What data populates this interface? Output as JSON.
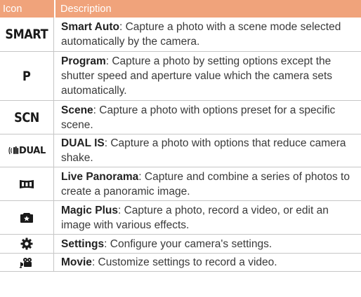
{
  "header": {
    "icon_col": "Icon",
    "desc_col": "Description"
  },
  "rows": [
    {
      "icon_text": "SMART",
      "icon_name": "smart-auto-icon",
      "term": "Smart Auto",
      "desc": ": Capture a photo with a scene mode selected automatically by the camera."
    },
    {
      "icon_text": "P",
      "icon_name": "program-icon",
      "term": "Program",
      "desc": ": Capture a photo by setting options except the shutter speed and aperture value which the camera sets automatically."
    },
    {
      "icon_text": "SCN",
      "icon_name": "scene-icon",
      "term": "Scene",
      "desc": ": Capture a photo with options preset for a specific scene."
    },
    {
      "icon_text": "DUAL",
      "icon_name": "dual-is-icon",
      "term": "DUAL IS",
      "desc": ": Capture a photo with options that reduce camera shake."
    },
    {
      "icon_name": "live-panorama-icon",
      "term": "Live Panorama",
      "desc": ": Capture and combine a series of photos to create a panoramic image."
    },
    {
      "icon_name": "magic-plus-icon",
      "term": "Magic Plus",
      "desc": ": Capture a photo, record a video, or edit an image with various effects."
    },
    {
      "icon_name": "settings-gear-icon",
      "term": "Settings",
      "desc": ": Configure your camera's settings."
    },
    {
      "icon_name": "movie-camera-icon",
      "term": "Movie",
      "desc": ": Customize settings to record a video."
    }
  ],
  "colors": {
    "header_bg": "#f0a37b",
    "header_text": "#ffffff",
    "border": "#c6c6c6"
  }
}
